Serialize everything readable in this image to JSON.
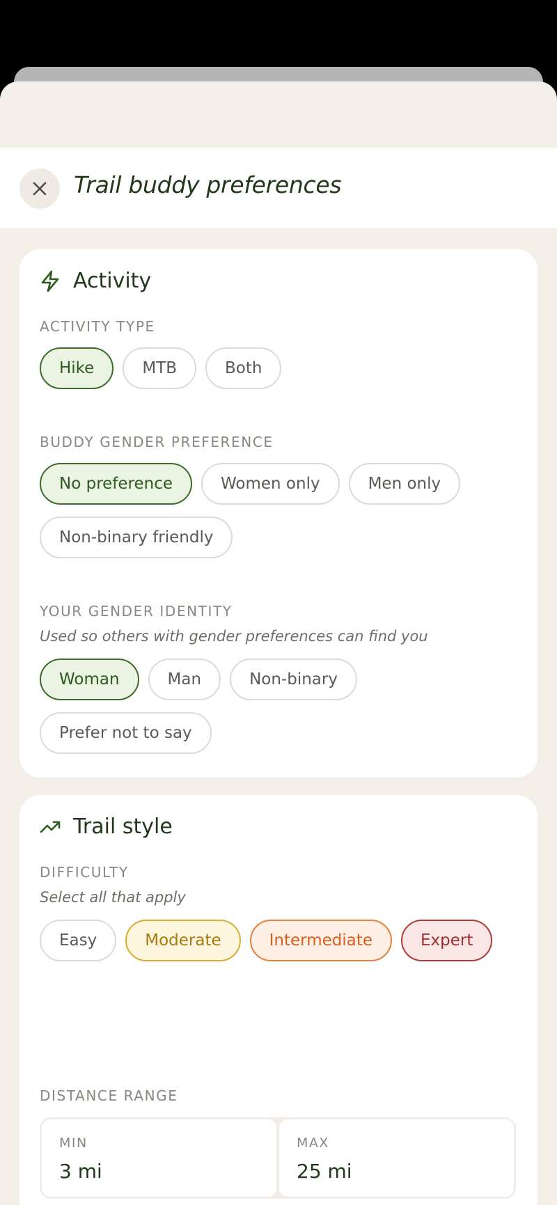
{
  "header": {
    "title": "Trail buddy preferences",
    "close_icon": "close-icon"
  },
  "activity": {
    "heading": "Activity",
    "icon": "lightning-icon",
    "activity_type": {
      "label": "ACTIVITY TYPE",
      "options": [
        "Hike",
        "MTB",
        "Both"
      ],
      "selected": "Hike"
    },
    "buddy_gender": {
      "label": "BUDDY GENDER PREFERENCE",
      "options": [
        "No preference",
        "Women only",
        "Men only",
        "Non-binary friendly"
      ],
      "selected": "No preference"
    },
    "your_gender": {
      "label": "YOUR GENDER IDENTITY",
      "hint": "Used so others with gender preferences can find you",
      "options": [
        "Woman",
        "Man",
        "Non-binary",
        "Prefer not to say"
      ],
      "selected": "Woman"
    }
  },
  "trail_style": {
    "heading": "Trail style",
    "icon": "trending-up-icon",
    "difficulty": {
      "label": "DIFFICULTY",
      "hint": "Select all that apply",
      "options": [
        "Easy",
        "Moderate",
        "Intermediate",
        "Expert"
      ],
      "selected": [
        "Moderate",
        "Intermediate",
        "Expert"
      ],
      "colors": {
        "moderate": "#d9ad35",
        "intermediate": "#e5813f",
        "expert": "#b23a3a"
      }
    },
    "distance": {
      "label": "DISTANCE RANGE",
      "min_label": "MIN",
      "min_value": "3 mi",
      "max_label": "MAX",
      "max_value": "25 mi"
    }
  },
  "colors": {
    "accent": "#3d6b2c",
    "background": "#f3efe8",
    "text_dark": "#22381b"
  }
}
